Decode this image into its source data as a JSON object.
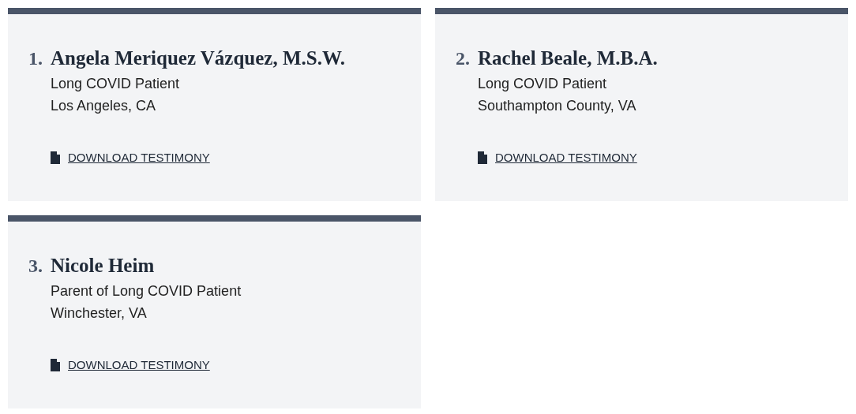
{
  "testimonies": [
    {
      "number": "1.",
      "name": "Angela Meriquez Vázquez, M.S.W.",
      "role": "Long COVID Patient",
      "location": "Los Angeles, CA",
      "link": "DOWNLOAD TESTIMONY"
    },
    {
      "number": "2.",
      "name": "Rachel Beale, M.B.A.",
      "role": "Long COVID Patient",
      "location": "Southampton County, VA",
      "link": "DOWNLOAD TESTIMONY"
    },
    {
      "number": "3.",
      "name": "Nicole Heim",
      "role": "Parent of Long COVID Patient",
      "location": "Winchester, VA",
      "link": "DOWNLOAD TESTIMONY"
    }
  ]
}
